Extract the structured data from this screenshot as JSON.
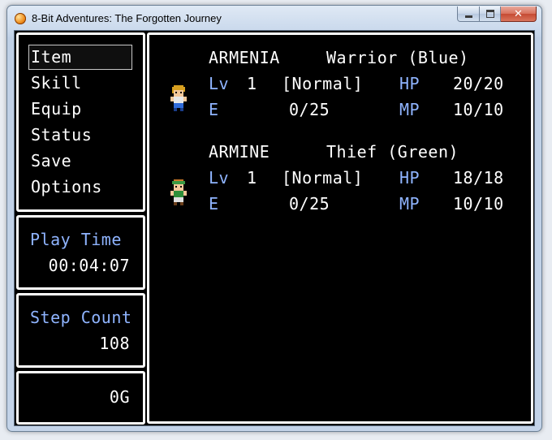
{
  "window": {
    "title": "8-Bit Adventures: The Forgotten Journey",
    "close_glyph": "✕"
  },
  "menu": {
    "selected_index": 0,
    "items": [
      "Item",
      "Skill",
      "Equip",
      "Status",
      "Save",
      "Options"
    ]
  },
  "play_time": {
    "label": "Play Time",
    "value": "00:04:07"
  },
  "step_count": {
    "label": "Step Count",
    "value": "108"
  },
  "gold": {
    "value": "0G"
  },
  "party": [
    {
      "name": "ARMENIA",
      "class": "Warrior (Blue)",
      "lv_label": "Lv",
      "lv": "1",
      "state": "[Normal]",
      "hp_label": "HP",
      "hp": "20/20",
      "e_label": "E",
      "exp": "0/25",
      "mp_label": "MP",
      "mp": "10/10",
      "sprite_color": "#2f6bd8"
    },
    {
      "name": "ARMINE",
      "class": "Thief (Green)",
      "lv_label": "Lv",
      "lv": "1",
      "state": "[Normal]",
      "hp_label": "HP",
      "hp": "18/18",
      "e_label": "E",
      "exp": "0/25",
      "mp_label": "MP",
      "mp": "10/10",
      "sprite_color": "#2e8f3a"
    }
  ]
}
